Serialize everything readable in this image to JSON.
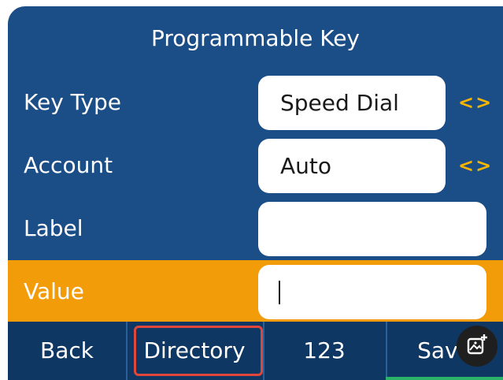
{
  "header": {
    "title": "Programmable Key"
  },
  "rows": [
    {
      "label": "Key Type",
      "value": "Speed Dial",
      "arrows": "<>"
    },
    {
      "label": "Account",
      "value": "Auto",
      "arrows": "<>"
    },
    {
      "label": "Label",
      "value": ""
    },
    {
      "label": "Value",
      "value": ""
    }
  ],
  "softkeys": {
    "back": "Back",
    "directory": "Directory",
    "input_mode": "123",
    "save": "Save"
  },
  "colors": {
    "background": "#1b4d86",
    "active_row": "#f39c0a",
    "arrows": "#f7b500",
    "highlight_border": "#e0463a",
    "save_underline": "#2bb36a"
  },
  "icons": {
    "floating_button": "screenshot-edit-icon"
  }
}
